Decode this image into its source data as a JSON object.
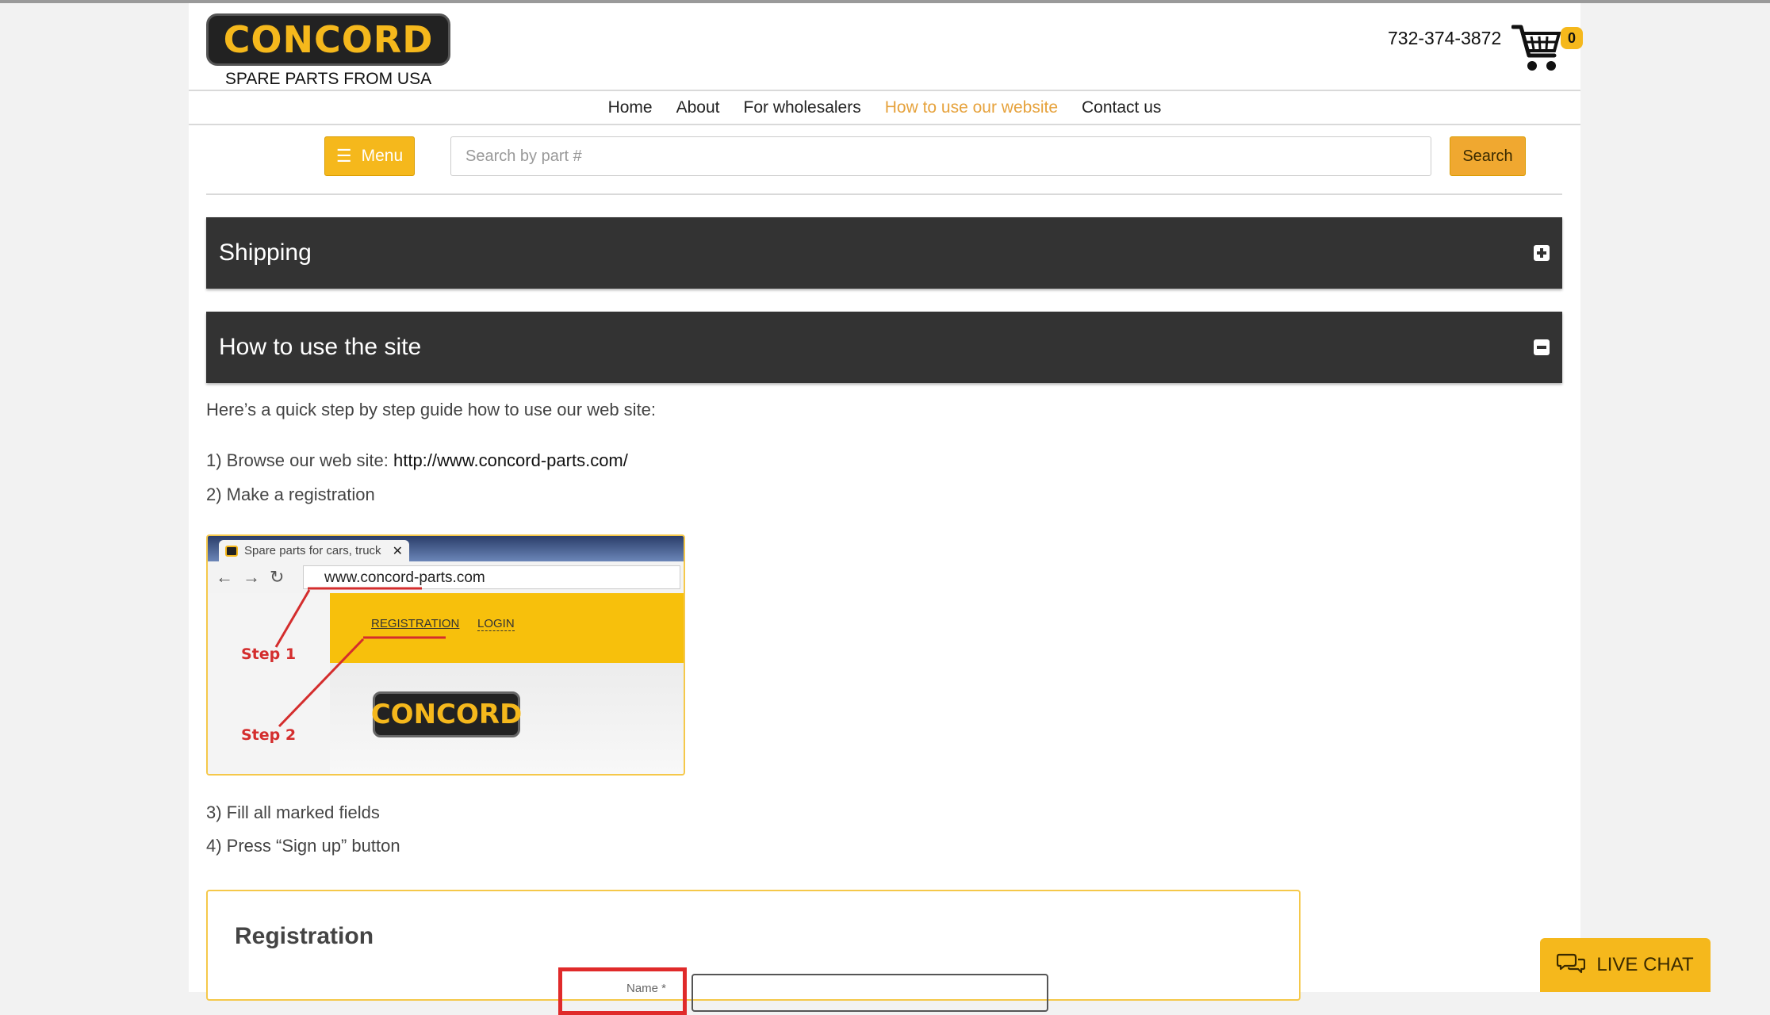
{
  "header": {
    "logo_text": "CONCORD",
    "tagline": "SPARE PARTS FROM USA",
    "phone": "732-374-3872",
    "cart_count": "0",
    "cart_icon": "shopping-cart-icon"
  },
  "nav": {
    "items": [
      {
        "label": "Home",
        "active": false
      },
      {
        "label": "About",
        "active": false
      },
      {
        "label": "For wholesalers",
        "active": false
      },
      {
        "label": "How to use our website",
        "active": true
      },
      {
        "label": "Contact us",
        "active": false
      }
    ],
    "active_color": "#e6a23c"
  },
  "toolbar": {
    "menu_label": "Menu",
    "search_placeholder": "Search by part #",
    "search_value": "",
    "search_button": "Search"
  },
  "accordion": [
    {
      "title": "Shipping",
      "icon": "plus-square-icon",
      "expanded": false
    },
    {
      "title": "How to use the site",
      "icon": "minus-square-icon",
      "expanded": true
    }
  ],
  "content": {
    "intro": "Here’s a quick step by step guide how to use our web site:",
    "step1_prefix": "1) Browse our web site: ",
    "step1_link": "http://www.concord-parts.com/",
    "step2": "2) Make a registration",
    "step3": "3) Fill all marked fields",
    "step4": "4) Press “Sign up” button"
  },
  "screenshot1": {
    "tab_title": "Spare parts for cars, truck",
    "url": "www.concord-parts.com",
    "registration_link": "REGISTRATION",
    "login_link": "LOGIN",
    "logo_text": "CONCORD",
    "step1_label": "Step 1",
    "step2_label": "Step 2"
  },
  "registration": {
    "title": "Registration",
    "name_label": "Name *"
  },
  "live_chat": {
    "label": "LIVE CHAT",
    "icon": "chat-bubbles-icon"
  },
  "colors": {
    "brand_yellow": "#f5b81c",
    "accordion_bg": "#333333",
    "highlight_red": "#e02a2a"
  }
}
